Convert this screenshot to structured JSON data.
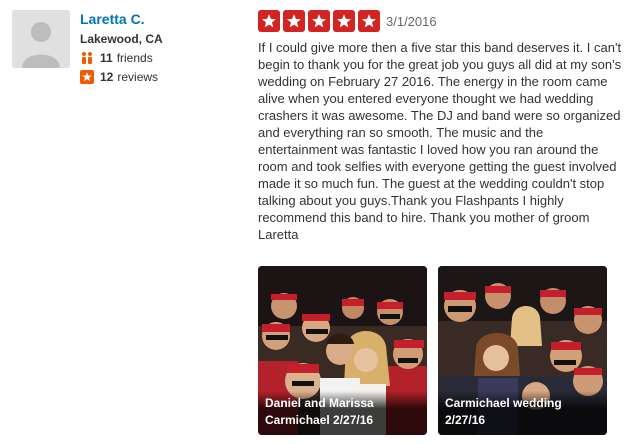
{
  "user": {
    "name": "Laretta C.",
    "location": "Lakewood, CA",
    "friends_count": "11",
    "friends_label": "friends",
    "reviews_count": "12",
    "reviews_label": "reviews",
    "icons": {
      "avatar": "default-user-silhouette",
      "friends": "friends-icon",
      "reviews": "star-badge-icon"
    }
  },
  "review": {
    "rating": 5,
    "rating_max": 5,
    "date": "3/1/2016",
    "text": "If I could give more then a five star this band deserves it. I can't begin to thank you for the great job you guys all did at my son's wedding on February 27 2016. The energy in the room came alive when you entered everyone thought we had wedding crashers it was awesome. The DJ and band were so organized and everything ran so smooth. The music and the entertainment was fantastic I loved how you ran around the room and took selfies with everyone getting the guest involved made it so much fun. The guest at the wedding couldn't stop talking about you guys.Thank you Flashpants I highly recommend this band to hire. Thank you mother of groom Laretta"
  },
  "photos": [
    {
      "caption_line1": "Daniel and Marissa",
      "caption_line2": "Carmichael 2/27/16"
    },
    {
      "caption_line1": "Carmichael wedding",
      "caption_line2": "2/27/16"
    }
  ],
  "colors": {
    "accent": "#d32323",
    "link": "#0073bb",
    "text": "#333333"
  }
}
